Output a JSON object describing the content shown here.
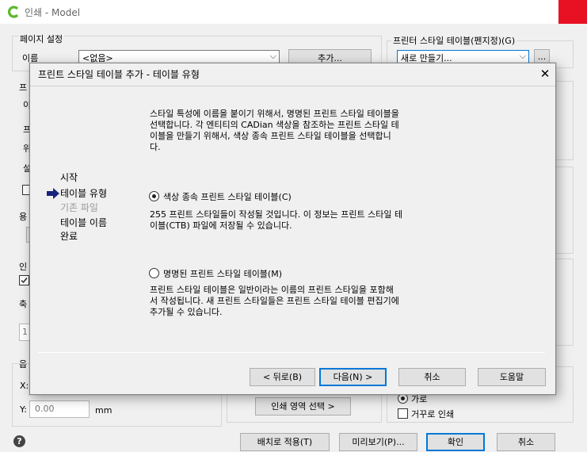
{
  "window": {
    "title": "인쇄 - Model",
    "brand_color": "#5cb82f"
  },
  "background": {
    "page_setup_label": "페이지 설정",
    "name_label": "이름",
    "name_value": "<없음>",
    "add_button": "추가...",
    "plot_style_table_label": "프린터 스타일 테이블(펜지정)(G)",
    "plot_style_table_value": "새로 만들기...",
    "x_label": "X:",
    "y_label": "Y:",
    "y_value": "0.00",
    "mm_label": "mm",
    "plot_area_button": "인쇄 영역 선택 >",
    "landscape_label": "가로",
    "upside_down_label": "거꾸로 인쇄",
    "apply_layout_button": "배치로 적용(T)",
    "preview_button": "미리보기(P)...",
    "ok_button": "확인",
    "cancel_button": "취소",
    "help_icon_glyph": "?",
    "partial": {
      "p1": "프",
      "p2": "이",
      "p3": "프",
      "p4": "위",
      "p5": "설",
      "p6": "용",
      "p7": "인",
      "p8": "축",
      "p9": "1",
      "p10": "옵"
    }
  },
  "dialog": {
    "title": "프린트 스타일 테이블 추가 - 테이블 유형",
    "close_glyph": "✕",
    "description": "스타일 특성에 이름을 붙이기 위해서, 명명된 프린트 스타일 테이블을\n선택합니다. 각 엔티티의 CADian 색상을 참조하는 프린트 스타일 테\n이블을 만들기 위해서, 색상 종속 프린트 스타일 테이블을 선택합니\n다.",
    "steps": [
      "시작",
      "테이블 유형",
      "기존 파일",
      "테이블 이름",
      "완료"
    ],
    "current_step": 1,
    "option_color_label": "색상 종속 프린트 스타일 테이블(C)",
    "option_color_desc": "255 프린트 스타일들이 작성될 것입니다. 이 정보는 프린트 스타일 테\n이블(CTB) 파일에 저장될 수 있습니다.",
    "option_named_label": "명명된 프린트 스타일 테이블(M)",
    "option_named_desc": "프린트 스타일 테이블은 일반이라는 이름의 프린트 스타일을 포함해\n서 작성됩니다. 새 프린트 스타일들은 프린트 스타일 테이블 편집기에\n추가될 수 있습니다.",
    "selected_option": "color",
    "back_button": "< 뒤로(B)",
    "next_button": "다음(N) >",
    "cancel_button": "취소",
    "help_button": "도움말",
    "accent_color": "#0078d7",
    "arrow_color": "#1a237e"
  }
}
